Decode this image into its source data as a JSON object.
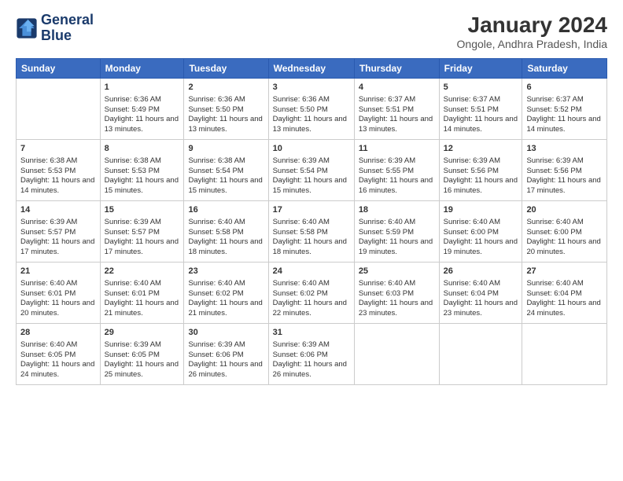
{
  "header": {
    "logo_line1": "General",
    "logo_line2": "Blue",
    "title": "January 2024",
    "subtitle": "Ongole, Andhra Pradesh, India"
  },
  "days_of_week": [
    "Sunday",
    "Monday",
    "Tuesday",
    "Wednesday",
    "Thursday",
    "Friday",
    "Saturday"
  ],
  "weeks": [
    [
      {
        "day": "",
        "sunrise": "",
        "sunset": "",
        "daylight": ""
      },
      {
        "day": "1",
        "sunrise": "Sunrise: 6:36 AM",
        "sunset": "Sunset: 5:49 PM",
        "daylight": "Daylight: 11 hours and 13 minutes."
      },
      {
        "day": "2",
        "sunrise": "Sunrise: 6:36 AM",
        "sunset": "Sunset: 5:50 PM",
        "daylight": "Daylight: 11 hours and 13 minutes."
      },
      {
        "day": "3",
        "sunrise": "Sunrise: 6:36 AM",
        "sunset": "Sunset: 5:50 PM",
        "daylight": "Daylight: 11 hours and 13 minutes."
      },
      {
        "day": "4",
        "sunrise": "Sunrise: 6:37 AM",
        "sunset": "Sunset: 5:51 PM",
        "daylight": "Daylight: 11 hours and 13 minutes."
      },
      {
        "day": "5",
        "sunrise": "Sunrise: 6:37 AM",
        "sunset": "Sunset: 5:51 PM",
        "daylight": "Daylight: 11 hours and 14 minutes."
      },
      {
        "day": "6",
        "sunrise": "Sunrise: 6:37 AM",
        "sunset": "Sunset: 5:52 PM",
        "daylight": "Daylight: 11 hours and 14 minutes."
      }
    ],
    [
      {
        "day": "7",
        "sunrise": "Sunrise: 6:38 AM",
        "sunset": "Sunset: 5:53 PM",
        "daylight": "Daylight: 11 hours and 14 minutes."
      },
      {
        "day": "8",
        "sunrise": "Sunrise: 6:38 AM",
        "sunset": "Sunset: 5:53 PM",
        "daylight": "Daylight: 11 hours and 15 minutes."
      },
      {
        "day": "9",
        "sunrise": "Sunrise: 6:38 AM",
        "sunset": "Sunset: 5:54 PM",
        "daylight": "Daylight: 11 hours and 15 minutes."
      },
      {
        "day": "10",
        "sunrise": "Sunrise: 6:39 AM",
        "sunset": "Sunset: 5:54 PM",
        "daylight": "Daylight: 11 hours and 15 minutes."
      },
      {
        "day": "11",
        "sunrise": "Sunrise: 6:39 AM",
        "sunset": "Sunset: 5:55 PM",
        "daylight": "Daylight: 11 hours and 16 minutes."
      },
      {
        "day": "12",
        "sunrise": "Sunrise: 6:39 AM",
        "sunset": "Sunset: 5:56 PM",
        "daylight": "Daylight: 11 hours and 16 minutes."
      },
      {
        "day": "13",
        "sunrise": "Sunrise: 6:39 AM",
        "sunset": "Sunset: 5:56 PM",
        "daylight": "Daylight: 11 hours and 17 minutes."
      }
    ],
    [
      {
        "day": "14",
        "sunrise": "Sunrise: 6:39 AM",
        "sunset": "Sunset: 5:57 PM",
        "daylight": "Daylight: 11 hours and 17 minutes."
      },
      {
        "day": "15",
        "sunrise": "Sunrise: 6:39 AM",
        "sunset": "Sunset: 5:57 PM",
        "daylight": "Daylight: 11 hours and 17 minutes."
      },
      {
        "day": "16",
        "sunrise": "Sunrise: 6:40 AM",
        "sunset": "Sunset: 5:58 PM",
        "daylight": "Daylight: 11 hours and 18 minutes."
      },
      {
        "day": "17",
        "sunrise": "Sunrise: 6:40 AM",
        "sunset": "Sunset: 5:58 PM",
        "daylight": "Daylight: 11 hours and 18 minutes."
      },
      {
        "day": "18",
        "sunrise": "Sunrise: 6:40 AM",
        "sunset": "Sunset: 5:59 PM",
        "daylight": "Daylight: 11 hours and 19 minutes."
      },
      {
        "day": "19",
        "sunrise": "Sunrise: 6:40 AM",
        "sunset": "Sunset: 6:00 PM",
        "daylight": "Daylight: 11 hours and 19 minutes."
      },
      {
        "day": "20",
        "sunrise": "Sunrise: 6:40 AM",
        "sunset": "Sunset: 6:00 PM",
        "daylight": "Daylight: 11 hours and 20 minutes."
      }
    ],
    [
      {
        "day": "21",
        "sunrise": "Sunrise: 6:40 AM",
        "sunset": "Sunset: 6:01 PM",
        "daylight": "Daylight: 11 hours and 20 minutes."
      },
      {
        "day": "22",
        "sunrise": "Sunrise: 6:40 AM",
        "sunset": "Sunset: 6:01 PM",
        "daylight": "Daylight: 11 hours and 21 minutes."
      },
      {
        "day": "23",
        "sunrise": "Sunrise: 6:40 AM",
        "sunset": "Sunset: 6:02 PM",
        "daylight": "Daylight: 11 hours and 21 minutes."
      },
      {
        "day": "24",
        "sunrise": "Sunrise: 6:40 AM",
        "sunset": "Sunset: 6:02 PM",
        "daylight": "Daylight: 11 hours and 22 minutes."
      },
      {
        "day": "25",
        "sunrise": "Sunrise: 6:40 AM",
        "sunset": "Sunset: 6:03 PM",
        "daylight": "Daylight: 11 hours and 23 minutes."
      },
      {
        "day": "26",
        "sunrise": "Sunrise: 6:40 AM",
        "sunset": "Sunset: 6:04 PM",
        "daylight": "Daylight: 11 hours and 23 minutes."
      },
      {
        "day": "27",
        "sunrise": "Sunrise: 6:40 AM",
        "sunset": "Sunset: 6:04 PM",
        "daylight": "Daylight: 11 hours and 24 minutes."
      }
    ],
    [
      {
        "day": "28",
        "sunrise": "Sunrise: 6:40 AM",
        "sunset": "Sunset: 6:05 PM",
        "daylight": "Daylight: 11 hours and 24 minutes."
      },
      {
        "day": "29",
        "sunrise": "Sunrise: 6:39 AM",
        "sunset": "Sunset: 6:05 PM",
        "daylight": "Daylight: 11 hours and 25 minutes."
      },
      {
        "day": "30",
        "sunrise": "Sunrise: 6:39 AM",
        "sunset": "Sunset: 6:06 PM",
        "daylight": "Daylight: 11 hours and 26 minutes."
      },
      {
        "day": "31",
        "sunrise": "Sunrise: 6:39 AM",
        "sunset": "Sunset: 6:06 PM",
        "daylight": "Daylight: 11 hours and 26 minutes."
      },
      {
        "day": "",
        "sunrise": "",
        "sunset": "",
        "daylight": ""
      },
      {
        "day": "",
        "sunrise": "",
        "sunset": "",
        "daylight": ""
      },
      {
        "day": "",
        "sunrise": "",
        "sunset": "",
        "daylight": ""
      }
    ]
  ]
}
